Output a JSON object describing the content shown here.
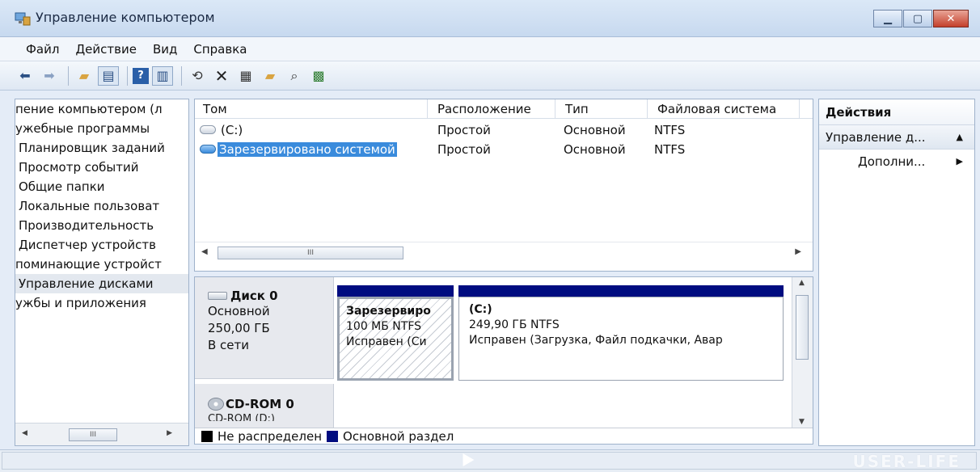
{
  "window": {
    "title": "Управление компьютером",
    "app_icon": "computer-management-icon",
    "buttons": {
      "minimize": "minimize-icon",
      "maximize": "maximize-icon",
      "close": "close-icon"
    }
  },
  "menu": [
    "Файл",
    "Действие",
    "Вид",
    "Справка"
  ],
  "toolbar": {
    "icons": [
      "back-arrow-icon",
      "forward-arrow-icon",
      "up-folder-icon",
      "show-hide-console-tree-icon",
      "help-icon",
      "show-hide-action-pane-icon",
      "refresh-icon",
      "delete-icon",
      "properties-icon",
      "open-folder-icon",
      "search-icon",
      "export-icon"
    ]
  },
  "tree": {
    "items": [
      "пение компьютером (л",
      "ужебные программы",
      "Планировщик заданий",
      "Просмотр событий",
      "Общие папки",
      "Локальные пользоват",
      "Производительность",
      "Диспетчер устройств",
      "поминающие устройст",
      "Управление дисками",
      "ужбы и приложения"
    ],
    "selected_index": 9,
    "scroll_thumb": "III"
  },
  "volumes": {
    "columns": [
      "Том",
      "Расположение",
      "Тип",
      "Файловая система"
    ],
    "rows": [
      {
        "name": "(C:)",
        "layout": "Простой",
        "type": "Основной",
        "fs": "NTFS",
        "selected": false
      },
      {
        "name": "Зарезервировано системой",
        "layout": "Простой",
        "type": "Основной",
        "fs": "NTFS",
        "selected": true
      }
    ],
    "scroll_thumb": "III"
  },
  "disks": {
    "disk0": {
      "name": "Диск 0",
      "type": "Основной",
      "size": "250,00 ГБ",
      "status": "В сети",
      "partitions": [
        {
          "name": "Зарезервиро",
          "size": "100 МБ NTFS",
          "status": "Исправен (Си"
        },
        {
          "name": "(C:)",
          "size": "249,90 ГБ NTFS",
          "status": "Исправен (Загрузка, Файл подкачки, Авар"
        }
      ]
    },
    "cdrom0": {
      "name": "CD-ROM 0",
      "sub": "CD-ROM (D:)"
    },
    "legend": [
      {
        "label": "Не распределен",
        "color": "#000000"
      },
      {
        "label": "Основной раздел",
        "color": "#000c80"
      }
    ]
  },
  "actions": {
    "header": "Действия",
    "section": "Управление д...",
    "item": "Дополни..."
  },
  "statusbar": {
    "watermark": "USER-LIFE"
  },
  "colors": {
    "selection": "#3a8bdc",
    "partition_bar": "#000c80",
    "close_button": "#c4402c"
  }
}
